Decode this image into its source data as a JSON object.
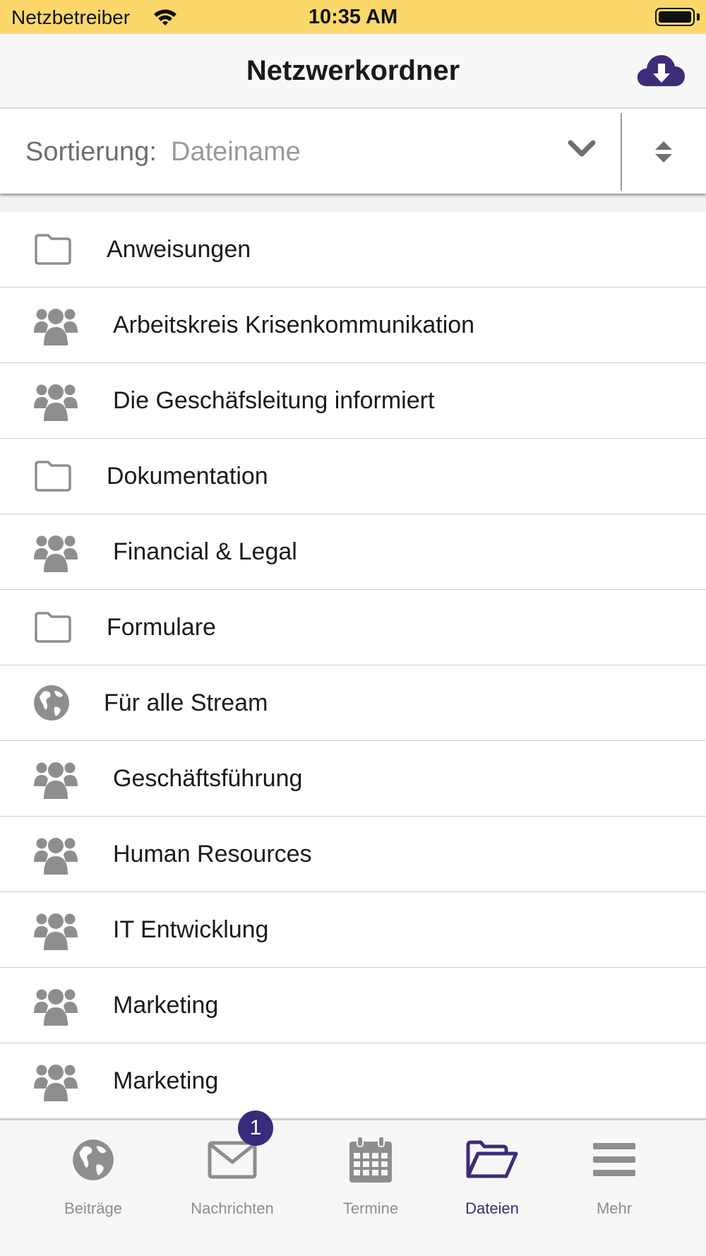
{
  "status_bar": {
    "carrier": "Netzbetreiber",
    "time": "10:35 AM"
  },
  "nav": {
    "title": "Netzwerkordner",
    "action_icon": "cloud-download-icon"
  },
  "sort": {
    "label": "Sortierung:",
    "value": "Dateiname"
  },
  "items": [
    {
      "label": "Anweisungen",
      "icon": "folder-icon"
    },
    {
      "label": "Arbeitskreis Krisenkommunikation",
      "icon": "group-icon"
    },
    {
      "label": "Die Geschäfsleitung informiert",
      "icon": "group-icon"
    },
    {
      "label": "Dokumentation",
      "icon": "folder-icon"
    },
    {
      "label": "Financial & Legal",
      "icon": "group-icon"
    },
    {
      "label": "Formulare",
      "icon": "folder-icon"
    },
    {
      "label": "Für alle Stream",
      "icon": "globe-icon"
    },
    {
      "label": "Geschäftsführung",
      "icon": "group-icon"
    },
    {
      "label": "Human Resources",
      "icon": "group-icon"
    },
    {
      "label": "IT Entwicklung",
      "icon": "group-icon"
    },
    {
      "label": "Marketing",
      "icon": "group-icon"
    },
    {
      "label": "Marketing",
      "icon": "group-icon"
    }
  ],
  "tabs": [
    {
      "label": "Beiträge",
      "icon": "globe-icon",
      "active": false
    },
    {
      "label": "Nachrichten",
      "icon": "envelope-icon",
      "active": false,
      "badge": "1"
    },
    {
      "label": "Termine",
      "icon": "calendar-icon",
      "active": false
    },
    {
      "label": "Dateien",
      "icon": "folder-open-icon",
      "active": true
    },
    {
      "label": "Mehr",
      "icon": "menu-icon",
      "active": false
    }
  ],
  "colors": {
    "status_bar": "#fcd86b",
    "accent": "#3e2c78",
    "icon_gray": "#8e8e8e"
  }
}
